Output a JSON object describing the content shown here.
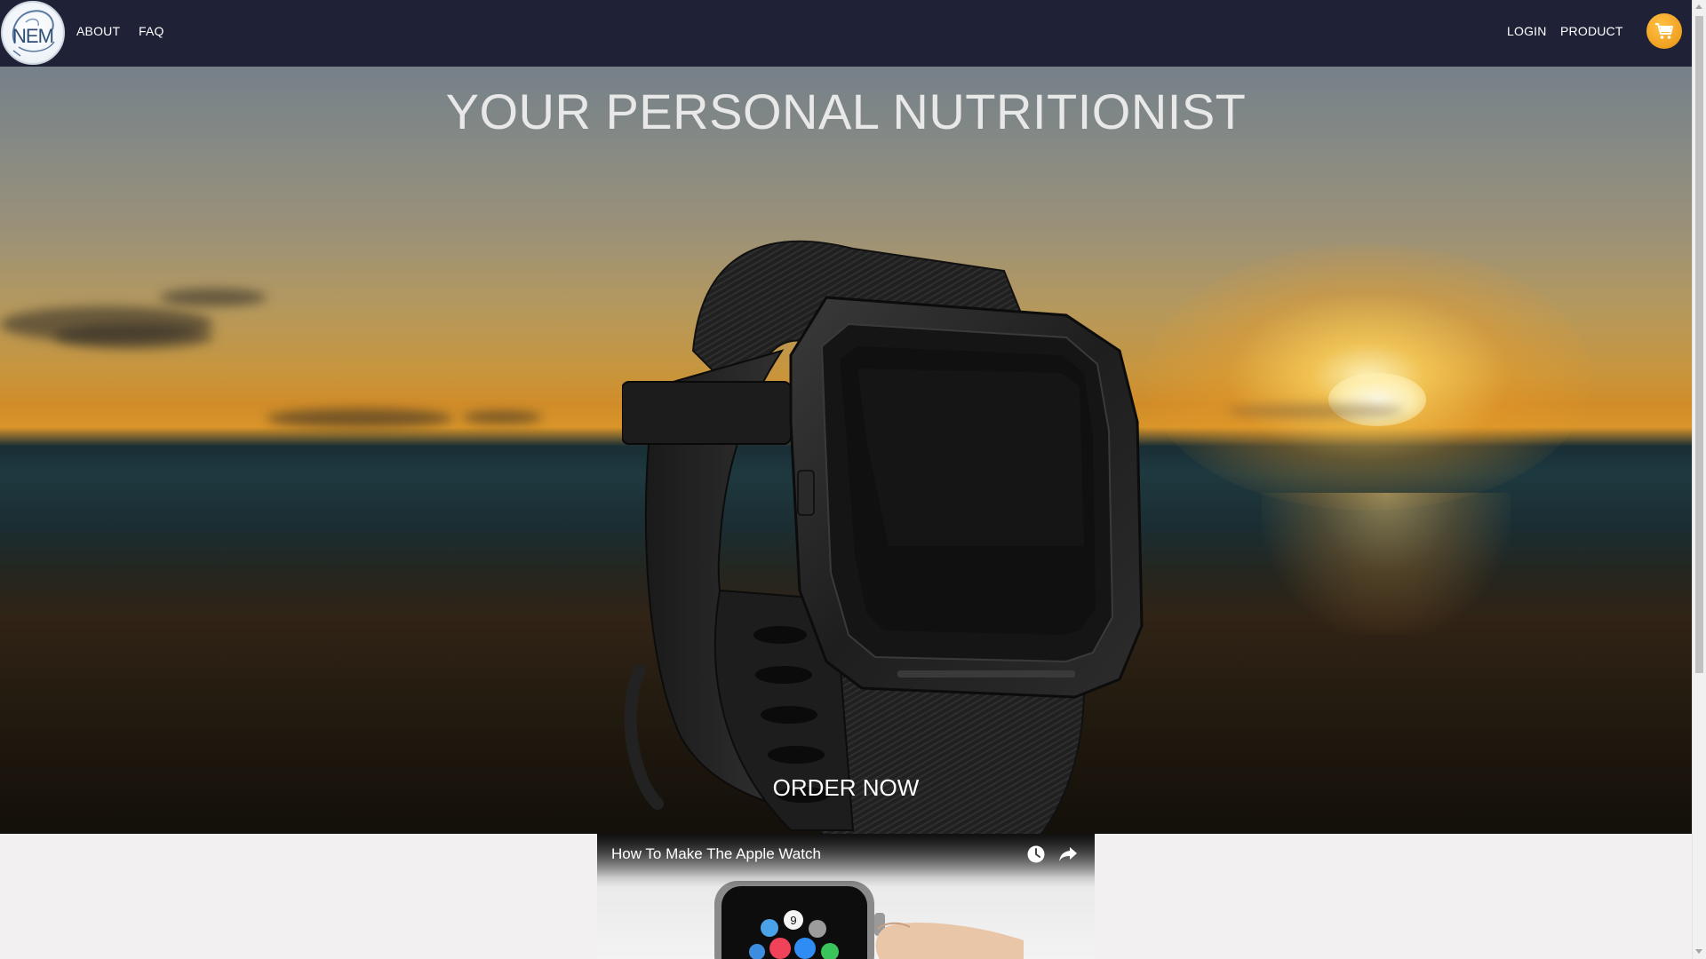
{
  "logo": {
    "text": "NEM"
  },
  "nav": {
    "left": [
      {
        "label": "ABOUT"
      },
      {
        "label": "FAQ"
      }
    ],
    "right": [
      {
        "label": "LOGIN"
      },
      {
        "label": "PRODUCT"
      }
    ],
    "cart_icon": "shopping-cart-icon"
  },
  "hero": {
    "title": "YOUR PERSONAL NUTRITIONIST",
    "cta": "ORDER NOW"
  },
  "video": {
    "title": "How To Make The Apple Watch",
    "watch_later_icon": "clock-icon",
    "share_icon": "share-arrow-icon",
    "app_badge": "9"
  },
  "colors": {
    "navbar": "#1f2237",
    "cart": "#f5a623",
    "page_bg": "#f2f0f1"
  }
}
